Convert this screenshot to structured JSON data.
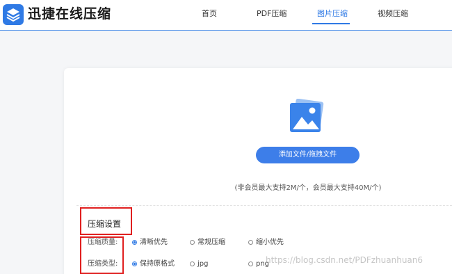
{
  "header": {
    "brand": "迅捷在线压缩",
    "nav": [
      {
        "label": "首页",
        "active": false
      },
      {
        "label": "PDF压缩",
        "active": false
      },
      {
        "label": "图片压缩",
        "active": true
      },
      {
        "label": "视频压缩",
        "active": false
      }
    ]
  },
  "upload": {
    "icon": "image-upload-icon",
    "button_label": "添加文件/拖拽文件",
    "note": "(非会员最大支持2M/个，会员最大支持40M/个)"
  },
  "settings": {
    "title": "压缩设置",
    "quality": {
      "label": "压缩质量:",
      "options": [
        {
          "label": "清晰优先",
          "selected": true
        },
        {
          "label": "常规压缩",
          "selected": false
        },
        {
          "label": "缩小优先",
          "selected": false
        }
      ]
    },
    "type": {
      "label": "压缩类型:",
      "options": [
        {
          "label": "保持原格式",
          "selected": true
        },
        {
          "label": "jpg",
          "selected": false
        },
        {
          "label": "png",
          "selected": false
        }
      ]
    }
  },
  "watermark": "https://blog.csdn.net/PDFzhuanhuan6",
  "colors": {
    "accent": "#2f7ae5",
    "button": "#3d7ee9",
    "highlight_box": "#e02020"
  }
}
